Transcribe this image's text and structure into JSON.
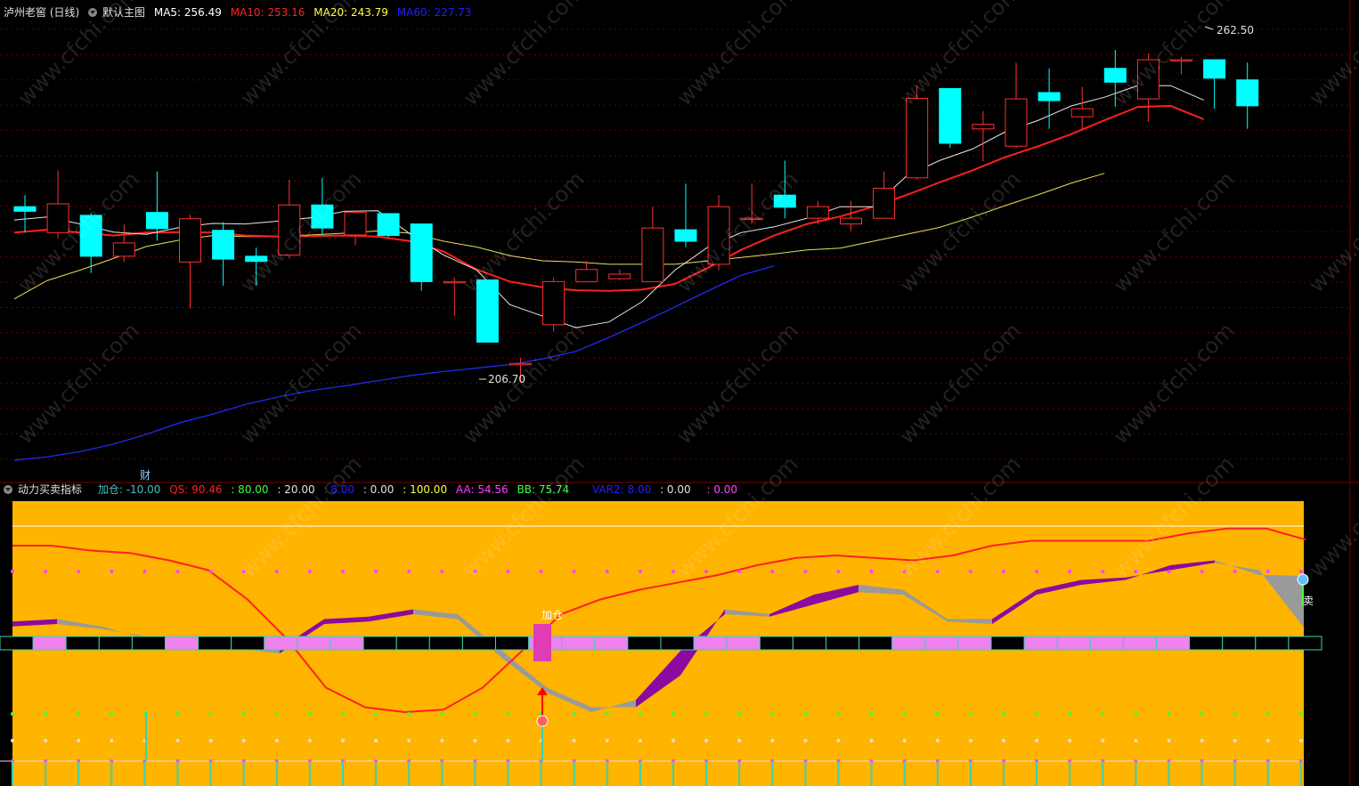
{
  "header": {
    "title": "泸州老窖 (日线)",
    "main_chart_label": "默认主图",
    "ma": [
      {
        "label": "MA5: 256.49",
        "color": "#ffffff"
      },
      {
        "label": "MA10: 253.16",
        "color": "#ff2020"
      },
      {
        "label": "MA20: 243.79",
        "color": "#ffff40"
      },
      {
        "label": "MA60: 227.73",
        "color": "#2020ff"
      }
    ]
  },
  "indicator_header": {
    "title": "动力买卖指标",
    "items": [
      {
        "label": "加仓: -10.00",
        "color": "#40c0c0"
      },
      {
        "label": "QS: 90.46",
        "color": "#ff2020"
      },
      {
        "label": ": 80.00",
        "color": "#40ff40"
      },
      {
        "label": ": 20.00",
        "color": "#e0e0e0"
      },
      {
        "label": ": 8.00",
        "color": "#2020ff"
      },
      {
        "label": ": 0.00",
        "color": "#e0e0e0"
      },
      {
        "label": ": 100.00",
        "color": "#ffff40"
      },
      {
        "label": "AA: 54.56",
        "color": "#ff40ff"
      },
      {
        "label": "BB: 75.74",
        "color": "#40ff40"
      },
      {
        "label": "VAR2: 8.00",
        "color": "#2020ff"
      },
      {
        "label": ": 0.00",
        "color": "#e0e0e0"
      },
      {
        "label": ": 0.00",
        "color": "#ff40ff"
      }
    ]
  },
  "annotations": {
    "high_label": "262.50",
    "low_label": "206.70",
    "cai_label": "财",
    "jiacang_label": "加仓",
    "sell_label": "卖"
  },
  "watermark": "www.cfchi.com",
  "chart_data": {
    "type": "candlestick",
    "ylim": [
      192,
      270
    ],
    "candles": [
      [
        238.0,
        237.2,
        240.0,
        233.5
      ],
      [
        233.5,
        238.5,
        244.3,
        232.5
      ],
      [
        236.5,
        229.4,
        236.9,
        226.5
      ],
      [
        229.4,
        231.7,
        234.9,
        228.4
      ],
      [
        237.0,
        234.2,
        244.1,
        232.1
      ],
      [
        228.4,
        235.9,
        236.6,
        220.3
      ],
      [
        233.9,
        228.9,
        235.3,
        224.3
      ],
      [
        229.4,
        228.5,
        230.9,
        224.3
      ],
      [
        229.6,
        238.3,
        242.7,
        229.0
      ],
      [
        238.3,
        234.3,
        243.0,
        233.1
      ],
      [
        233.1,
        237.0,
        237.3,
        231.3
      ],
      [
        236.8,
        233.0,
        236.8,
        232.7
      ],
      [
        235.0,
        225.0,
        235.0,
        223.4
      ],
      [
        225.0,
        225.0,
        225.7,
        219.0
      ],
      [
        225.3,
        214.5,
        225.3,
        214.5
      ],
      [
        210.8,
        210.8,
        211.8,
        207.7
      ],
      [
        217.5,
        225.0,
        225.7,
        216.3
      ],
      [
        225.0,
        227.1,
        228.6,
        225.0
      ],
      [
        225.5,
        226.3,
        227.1,
        225.3
      ],
      [
        225.0,
        234.3,
        238.0,
        225.0
      ],
      [
        234.0,
        232.0,
        242.0,
        231.0
      ],
      [
        228.0,
        238.0,
        240.0,
        227.0
      ],
      [
        236.0,
        236.0,
        242.0,
        235.0
      ],
      [
        240.0,
        237.9,
        246.0,
        236.0
      ],
      [
        236.0,
        238.0,
        239.0,
        235.0
      ],
      [
        235.0,
        236.0,
        239.0,
        233.8
      ],
      [
        236.0,
        241.2,
        244.1,
        236.0
      ],
      [
        243.0,
        256.8,
        259.0,
        242.7
      ],
      [
        258.5,
        249.0,
        258.5,
        248.2
      ],
      [
        251.5,
        252.3,
        254.6,
        245.9
      ],
      [
        248.5,
        256.7,
        263.0,
        248.2
      ],
      [
        257.8,
        256.4,
        262.0,
        251.5
      ],
      [
        253.6,
        255.0,
        258.8,
        251.5
      ],
      [
        262.0,
        259.6,
        265.2,
        255.3
      ],
      [
        256.7,
        263.5,
        264.6,
        252.7
      ],
      [
        263.5,
        263.5,
        264.0,
        261.0
      ],
      [
        263.5,
        260.3,
        263.5,
        255.0
      ],
      [
        260.0,
        255.5,
        263.0,
        251.5
      ]
    ],
    "ma5": [
      235.7,
      236.2,
      235.0,
      233.6,
      233.2,
      234.4,
      235.1,
      235.0,
      235.5,
      236.1,
      237.2,
      237.3,
      233.2,
      229.6,
      227.0,
      221.0,
      219.0,
      217.0,
      218.0,
      221.5,
      227.0,
      231.0,
      233.5,
      234.5,
      236.0,
      238.0,
      238.0,
      243.3,
      246.0,
      248.0,
      251.0,
      253.0,
      255.5,
      257.0,
      259.0,
      259.0,
      256.5
    ],
    "ma10": [
      233.5,
      234.0,
      233.5,
      233.0,
      233.5,
      233.6,
      233.5,
      233.0,
      232.8,
      232.9,
      233.0,
      232.8,
      232.0,
      230.2,
      227.1,
      225.0,
      224.0,
      223.5,
      223.4,
      223.6,
      224.6,
      227.4,
      230.5,
      233.0,
      235.0,
      236.3,
      238.0,
      240.0,
      242.2,
      244.3,
      246.6,
      248.5,
      250.6,
      253.0,
      255.3,
      255.5,
      253.16
    ],
    "ma20": [
      222.0,
      225.2,
      227.0,
      229.0,
      231.1,
      232.2,
      233.0,
      232.8,
      232.8,
      233.1,
      233.4,
      233.8,
      233.4,
      232.0,
      231.0,
      229.5,
      228.6,
      228.4,
      228.0,
      228.0,
      228.0,
      228.6,
      229.2,
      229.8,
      230.5,
      230.8,
      232.0,
      233.2,
      234.4,
      236.2,
      238.2,
      240.1,
      242.1,
      243.79
    ],
    "ma60": [
      194.0,
      194.6,
      195.5,
      196.8,
      198.5,
      200.5,
      202.0,
      203.7,
      205.0,
      206.1,
      206.9,
      207.8,
      208.7,
      209.4,
      210.0,
      210.6,
      211.6,
      212.9,
      215.3,
      217.9,
      220.6,
      223.4,
      226.1,
      227.73
    ],
    "indicator": {
      "ylim": [
        0,
        100
      ],
      "qs": [
        88,
        88,
        86,
        85,
        82,
        78,
        66,
        50,
        30,
        22,
        20,
        21,
        30,
        45,
        60,
        66,
        70,
        73,
        76,
        80,
        83,
        84,
        83,
        82,
        84,
        88,
        90,
        90,
        90,
        90,
        93,
        95,
        95,
        90.46
      ],
      "aa": [
        57,
        58,
        55,
        50,
        50,
        46,
        46,
        58,
        59,
        62,
        60,
        45,
        30,
        22,
        22,
        35,
        62,
        60,
        68,
        72,
        70,
        58,
        58,
        70,
        74,
        75,
        78,
        81,
        78,
        54.56
      ],
      "bb": [
        55,
        56,
        54,
        51,
        49,
        46,
        44,
        56,
        57,
        60,
        58,
        42,
        28,
        20,
        25,
        45,
        60,
        59,
        64,
        69,
        68,
        57,
        56,
        68,
        72,
        74,
        80,
        82,
        76,
        75.74
      ],
      "band_up": [
        0,
        1,
        0,
        0,
        0,
        1,
        0,
        0,
        1,
        1,
        1,
        0,
        0,
        0,
        0,
        0,
        1,
        1,
        1,
        0,
        0,
        1,
        1,
        0,
        0,
        0,
        0,
        1,
        1,
        1,
        0,
        1,
        1,
        1,
        1,
        1,
        0,
        0,
        0,
        0
      ]
    }
  }
}
